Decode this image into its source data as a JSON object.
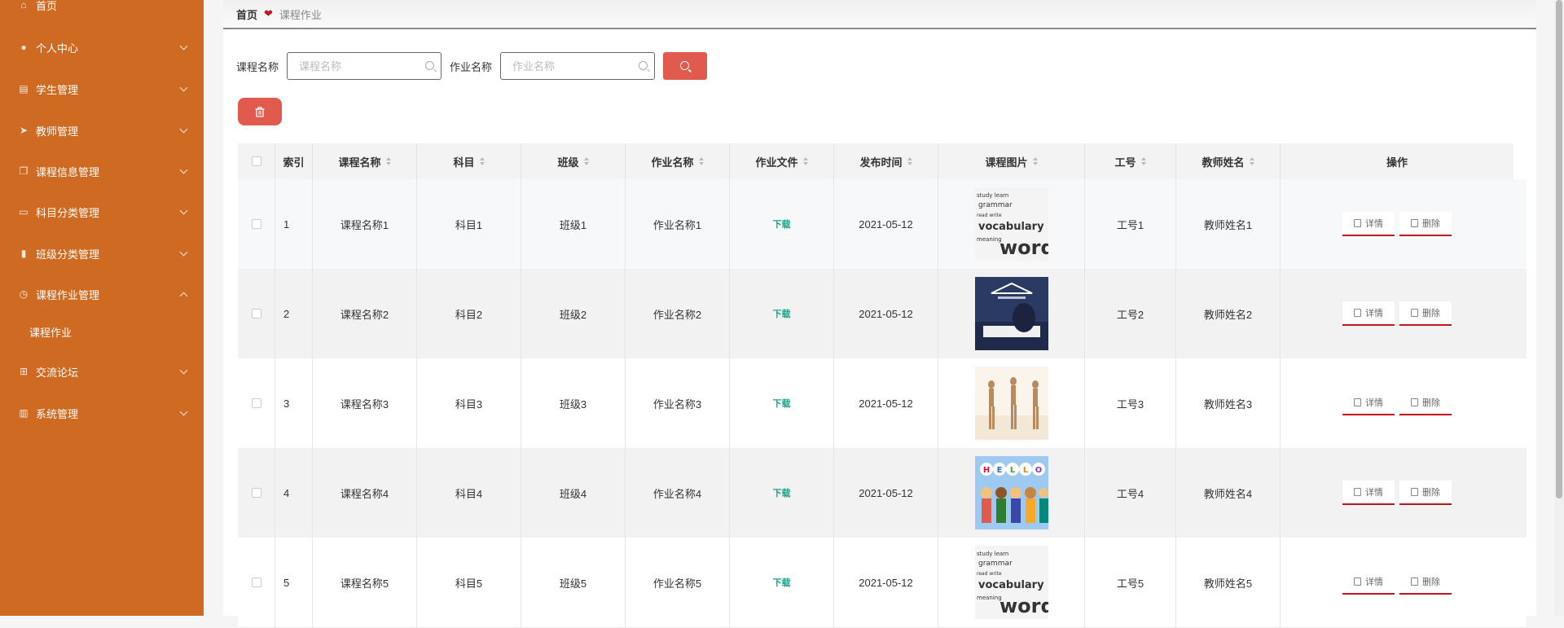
{
  "sidebar": {
    "items": [
      {
        "label": "首页",
        "icon": "home-icon",
        "expandable": false
      },
      {
        "label": "个人中心",
        "icon": "user-icon",
        "expandable": true
      },
      {
        "label": "学生管理",
        "icon": "building-icon",
        "expandable": true
      },
      {
        "label": "教师管理",
        "icon": "send-icon",
        "expandable": true
      },
      {
        "label": "课程信息管理",
        "icon": "copy-icon",
        "expandable": true
      },
      {
        "label": "科目分类管理",
        "icon": "message-icon",
        "expandable": true
      },
      {
        "label": "班级分类管理",
        "icon": "bar-chart-icon",
        "expandable": true
      },
      {
        "label": "课程作业管理",
        "icon": "clock-icon",
        "expandable": true,
        "expanded": true
      },
      {
        "label": "交流论坛",
        "icon": "grid-icon",
        "expandable": true
      },
      {
        "label": "系统管理",
        "icon": "chart-icon",
        "expandable": true
      }
    ],
    "submenu": {
      "label": "课程作业"
    },
    "bg_color": "#cf6a22"
  },
  "breadcrumb": {
    "home": "首页",
    "current": "课程作业"
  },
  "search": {
    "course_label": "课程名称",
    "course_placeholder": "课程名称",
    "homework_label": "作业名称",
    "homework_placeholder": "作业名称"
  },
  "table": {
    "headers": [
      "索引",
      "课程名称",
      "科目",
      "班级",
      "作业名称",
      "作业文件",
      "发布时间",
      "课程图片",
      "工号",
      "教师姓名",
      "操作"
    ],
    "rows": [
      {
        "index": "1",
        "course": "课程名称1",
        "subject": "科目1",
        "class": "班级1",
        "homework": "作业名称1",
        "file": "下载",
        "date": "2021-05-12",
        "image": "words",
        "staff_no": "工号1",
        "teacher": "教师姓名1"
      },
      {
        "index": "2",
        "course": "课程名称2",
        "subject": "科目2",
        "class": "班级2",
        "homework": "作业名称2",
        "file": "下载",
        "date": "2021-05-12",
        "image": "study",
        "staff_no": "工号2",
        "teacher": "教师姓名2"
      },
      {
        "index": "3",
        "course": "课程名称3",
        "subject": "科目3",
        "class": "班级3",
        "homework": "作业名称3",
        "file": "下载",
        "date": "2021-05-12",
        "image": "dance",
        "staff_no": "工号3",
        "teacher": "教师姓名3"
      },
      {
        "index": "4",
        "course": "课程名称4",
        "subject": "科目4",
        "class": "班级4",
        "homework": "作业名称4",
        "file": "下载",
        "date": "2021-05-12",
        "image": "hello",
        "staff_no": "工号4",
        "teacher": "教师姓名4"
      },
      {
        "index": "5",
        "course": "课程名称5",
        "subject": "科目5",
        "class": "班级5",
        "homework": "作业名称5",
        "file": "下载",
        "date": "2021-05-12",
        "image": "words",
        "staff_no": "工号5",
        "teacher": "教师姓名5"
      }
    ],
    "actions": {
      "detail": "详情",
      "delete": "删除"
    }
  },
  "colors": {
    "accent": "#e05a4e",
    "link": "#17a589",
    "underline": "#c0161c"
  }
}
